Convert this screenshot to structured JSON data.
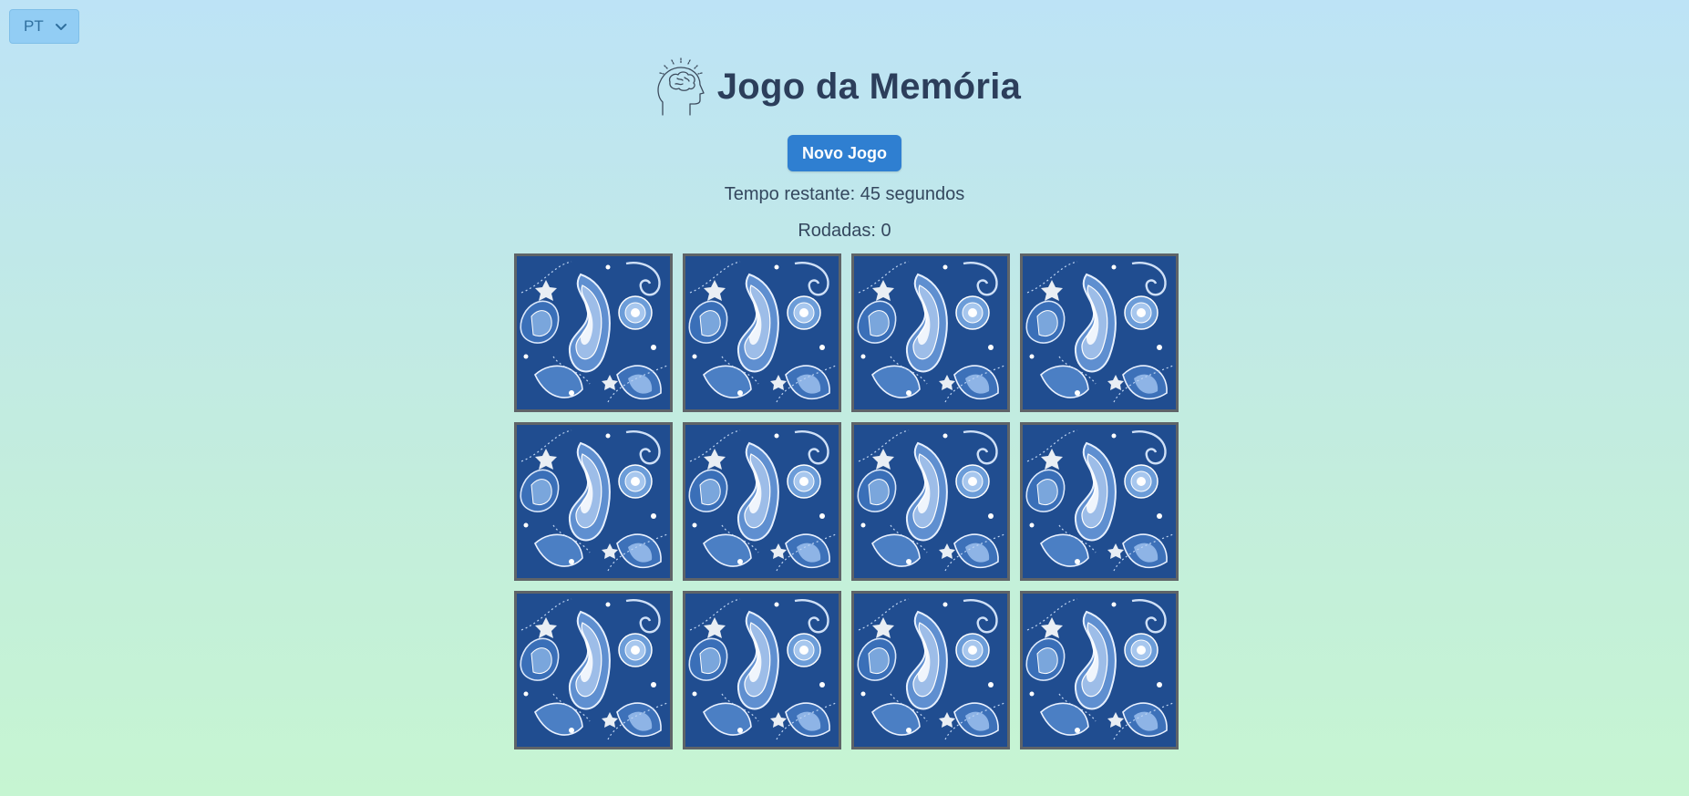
{
  "language": {
    "selected": "PT"
  },
  "header": {
    "title": "Jogo da Memória"
  },
  "controls": {
    "new_game_label": "Novo Jogo"
  },
  "status": {
    "time_remaining": "Tempo restante: 45 segundos",
    "rounds": "Rodadas: 0"
  },
  "board": {
    "rows": 3,
    "columns": 4,
    "cards": [
      {
        "state": "face-down"
      },
      {
        "state": "face-down"
      },
      {
        "state": "face-down"
      },
      {
        "state": "face-down"
      },
      {
        "state": "face-down"
      },
      {
        "state": "face-down"
      },
      {
        "state": "face-down"
      },
      {
        "state": "face-down"
      },
      {
        "state": "face-down"
      },
      {
        "state": "face-down"
      },
      {
        "state": "face-down"
      },
      {
        "state": "face-down"
      }
    ],
    "card_back_pattern": "blue-paisley"
  },
  "colors": {
    "accent": "#2f7fd1",
    "title": "#2c3e5b",
    "card_border": "#5f6468",
    "card_back_base": "#1f4f8f"
  }
}
